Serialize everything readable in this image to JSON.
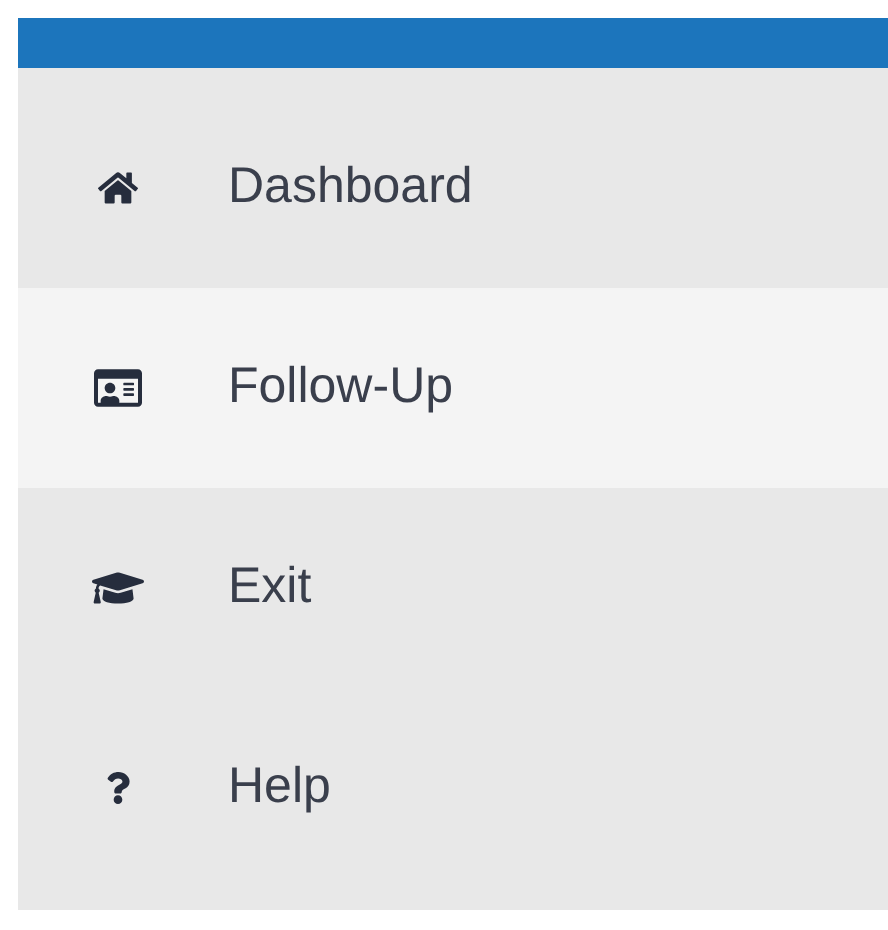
{
  "menu": {
    "items": [
      {
        "label": "Dashboard",
        "selected": false
      },
      {
        "label": "Follow-Up",
        "selected": true
      },
      {
        "label": "Exit",
        "selected": false
      },
      {
        "label": "Help",
        "selected": false
      }
    ]
  }
}
